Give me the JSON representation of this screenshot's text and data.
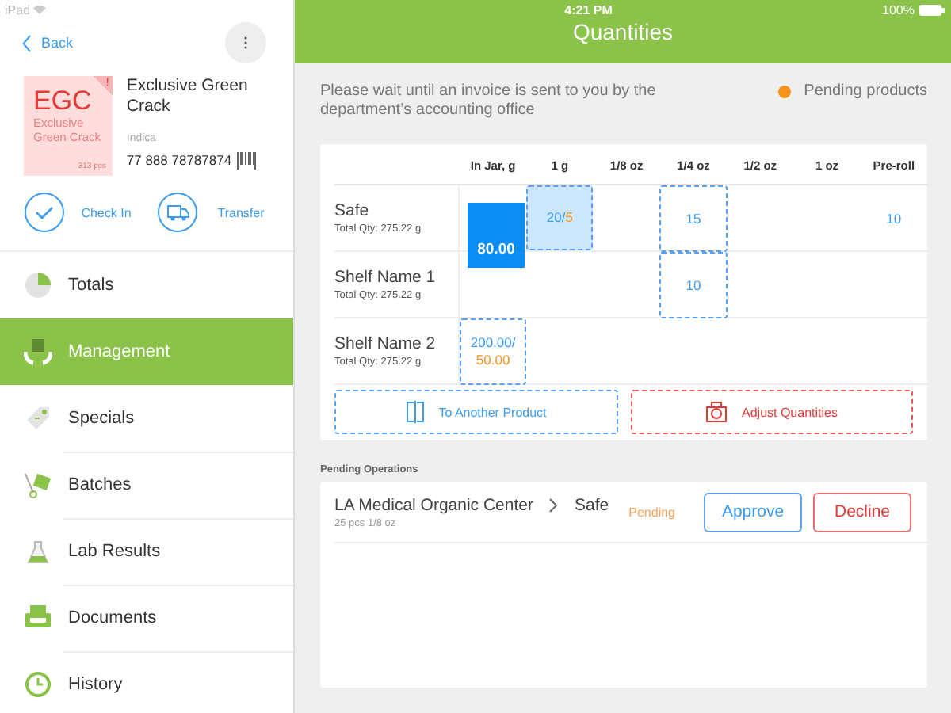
{
  "status_bar": {
    "device": "iPad",
    "time": "4:21 PM",
    "battery": "100%"
  },
  "sidebar": {
    "back": "Back",
    "product": {
      "code": "EGC",
      "tile_name": "Exclusive Green Crack",
      "count": "313 pcs",
      "alert": "!",
      "name": "Exclusive Green Crack",
      "strain": "Indica",
      "barcode": "77 888 78787874"
    },
    "actions": [
      "Check In",
      "Transfer"
    ],
    "items": [
      {
        "label": "Totals",
        "selected": false
      },
      {
        "label": "Management",
        "selected": true
      },
      {
        "label": "Specials",
        "selected": false
      },
      {
        "label": "Batches",
        "selected": false
      },
      {
        "label": "Lab Results",
        "selected": false
      },
      {
        "label": "Documents",
        "selected": false
      },
      {
        "label": "History",
        "selected": false
      }
    ]
  },
  "header": {
    "title": "Quantities"
  },
  "notice": "Please wait until an invoice is sent to you by the department’s accounting office",
  "legend": "Pending products",
  "table": {
    "columns": [
      "In Jar, g",
      "1 g",
      "1/8 oz",
      "1/4 oz",
      "1/2 oz",
      "1 oz",
      "Pre-roll"
    ],
    "rows": [
      {
        "name": "Safe",
        "total": "Total Qty: 275.22 g",
        "cells": [
          {
            "kind": "solid",
            "value": "80.00"
          },
          {
            "kind": "shaded",
            "value": "20/",
            "pending": "5"
          },
          {
            "kind": "empty"
          },
          {
            "kind": "dashed",
            "value": "15"
          },
          {
            "kind": "empty"
          },
          {
            "kind": "empty"
          },
          {
            "kind": "plain",
            "value": "10"
          }
        ]
      },
      {
        "name": "Shelf Name 1",
        "total": "Total Qty: 275.22 g",
        "cells": [
          {
            "kind": "empty"
          },
          {
            "kind": "empty"
          },
          {
            "kind": "empty"
          },
          {
            "kind": "dashed",
            "value": "10"
          },
          {
            "kind": "empty"
          },
          {
            "kind": "empty"
          },
          {
            "kind": "empty"
          }
        ]
      },
      {
        "name": "Shelf Name 2",
        "total": "Total Qty: 275.22 g",
        "cells": [
          {
            "kind": "dashed",
            "value": "200.00/",
            "pending": "50.00",
            "stacked": true
          },
          {
            "kind": "empty"
          },
          {
            "kind": "empty"
          },
          {
            "kind": "empty"
          },
          {
            "kind": "empty"
          },
          {
            "kind": "empty"
          },
          {
            "kind": "empty"
          }
        ]
      }
    ]
  },
  "table_actions": [
    {
      "label": "To Another Product",
      "kind": "move"
    },
    {
      "label": "Adjust Quantities",
      "kind": "adjust"
    }
  ],
  "pending": {
    "title": "Pending Operations",
    "operations": [
      {
        "source": "LA Medical Organic Center",
        "target": "Safe",
        "detail": "25 pcs 1/8 oz",
        "status": "Pending",
        "approve": "Approve",
        "decline": "Decline"
      }
    ]
  }
}
